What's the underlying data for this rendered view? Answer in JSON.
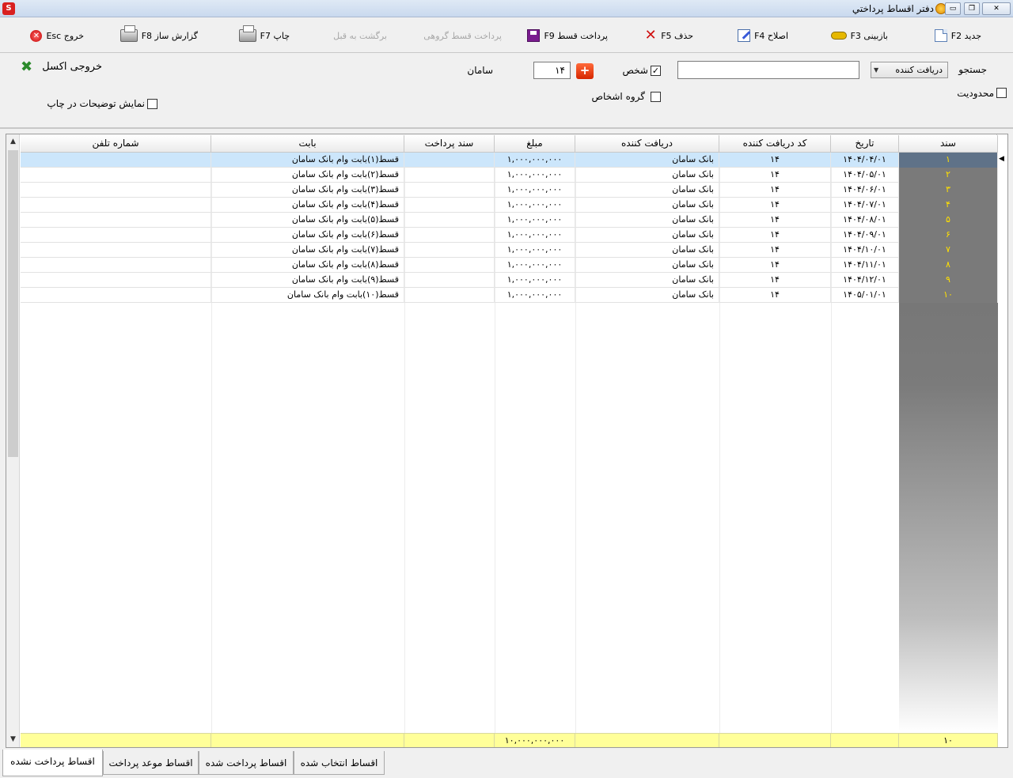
{
  "window": {
    "title": "دفتر اقساط پرداختي",
    "logo_text": "S",
    "controls": {
      "minimize": "▭",
      "restore": "❐",
      "close": "✕"
    }
  },
  "toolbar": {
    "new": "جدید F2",
    "review": "بازبینی F3",
    "edit": "اصلاح F4",
    "delete": "حذف F5",
    "pay_installment": "پرداخت قسط F9",
    "group_pay": "پرداخت  قسط گروهی",
    "undo": "برگشت به قبل",
    "print": "چاپ F7",
    "report_builder": "گزارش ساز F8",
    "exit": "خروج Esc"
  },
  "search": {
    "label": "جستجو",
    "type_select": "دریافت کننده",
    "query_value": "",
    "limit_label": "محدودیت",
    "limit_checked": false,
    "person_label": "شخص",
    "person_checked": true,
    "group_label": "گروه اشخاص",
    "group_checked": false,
    "code_value": "۱۴",
    "add_symbol": "+",
    "person_name": "سامان",
    "excel_label": "خروجی اکسل",
    "show_notes_label": "نمایش توضیحات در چاپ",
    "show_notes_checked": false
  },
  "grid": {
    "columns": [
      "سند",
      "تاریخ",
      "کد دریافت کننده",
      "دریافت کننده",
      "مبلغ",
      "سند پرداخت",
      "بابت",
      "شماره تلفن"
    ],
    "rows": [
      {
        "sanad": "۱",
        "date": "۱۴۰۴/۰۴/۰۱",
        "code": "۱۴",
        "receiver": "بانک سامان",
        "amount": "۱,۰۰۰,۰۰۰,۰۰۰",
        "pay_doc": "",
        "for": "قسط(۱)بابت وام بانک سامان",
        "phone": ""
      },
      {
        "sanad": "۲",
        "date": "۱۴۰۴/۰۵/۰۱",
        "code": "۱۴",
        "receiver": "بانک سامان",
        "amount": "۱,۰۰۰,۰۰۰,۰۰۰",
        "pay_doc": "",
        "for": "قسط(۲)بابت وام بانک سامان",
        "phone": ""
      },
      {
        "sanad": "۳",
        "date": "۱۴۰۴/۰۶/۰۱",
        "code": "۱۴",
        "receiver": "بانک سامان",
        "amount": "۱,۰۰۰,۰۰۰,۰۰۰",
        "pay_doc": "",
        "for": "قسط(۳)بابت وام بانک سامان",
        "phone": ""
      },
      {
        "sanad": "۴",
        "date": "۱۴۰۴/۰۷/۰۱",
        "code": "۱۴",
        "receiver": "بانک سامان",
        "amount": "۱,۰۰۰,۰۰۰,۰۰۰",
        "pay_doc": "",
        "for": "قسط(۴)بابت وام بانک سامان",
        "phone": ""
      },
      {
        "sanad": "۵",
        "date": "۱۴۰۴/۰۸/۰۱",
        "code": "۱۴",
        "receiver": "بانک سامان",
        "amount": "۱,۰۰۰,۰۰۰,۰۰۰",
        "pay_doc": "",
        "for": "قسط(۵)بابت وام بانک سامان",
        "phone": ""
      },
      {
        "sanad": "۶",
        "date": "۱۴۰۴/۰۹/۰۱",
        "code": "۱۴",
        "receiver": "بانک سامان",
        "amount": "۱,۰۰۰,۰۰۰,۰۰۰",
        "pay_doc": "",
        "for": "قسط(۶)بابت وام بانک سامان",
        "phone": ""
      },
      {
        "sanad": "۷",
        "date": "۱۴۰۴/۱۰/۰۱",
        "code": "۱۴",
        "receiver": "بانک سامان",
        "amount": "۱,۰۰۰,۰۰۰,۰۰۰",
        "pay_doc": "",
        "for": "قسط(۷)بابت وام بانک سامان",
        "phone": ""
      },
      {
        "sanad": "۸",
        "date": "۱۴۰۴/۱۱/۰۱",
        "code": "۱۴",
        "receiver": "بانک سامان",
        "amount": "۱,۰۰۰,۰۰۰,۰۰۰",
        "pay_doc": "",
        "for": "قسط(۸)بابت وام بانک سامان",
        "phone": ""
      },
      {
        "sanad": "۹",
        "date": "۱۴۰۴/۱۲/۰۱",
        "code": "۱۴",
        "receiver": "بانک سامان",
        "amount": "۱,۰۰۰,۰۰۰,۰۰۰",
        "pay_doc": "",
        "for": "قسط(۹)بابت وام بانک سامان",
        "phone": ""
      },
      {
        "sanad": "۱۰",
        "date": "۱۴۰۵/۰۱/۰۱",
        "code": "۱۴",
        "receiver": "بانک سامان",
        "amount": "۱,۰۰۰,۰۰۰,۰۰۰",
        "pay_doc": "",
        "for": "قسط(۱۰)بابت وام بانک سامان",
        "phone": ""
      }
    ],
    "selected_row": 0,
    "footer": {
      "count": "۱۰",
      "total_amount": "۱۰,۰۰۰,۰۰۰,۰۰۰"
    }
  },
  "tabs": [
    "اقساط پرداخت نشده",
    "اقساط موعد پرداخت",
    "اقساط پرداخت شده",
    "اقساط انتخاب شده"
  ],
  "active_tab": 0,
  "colors": {
    "sanad_text": "#ffe000",
    "selected_row": "#cce6fb",
    "footer": "#ffff99"
  }
}
